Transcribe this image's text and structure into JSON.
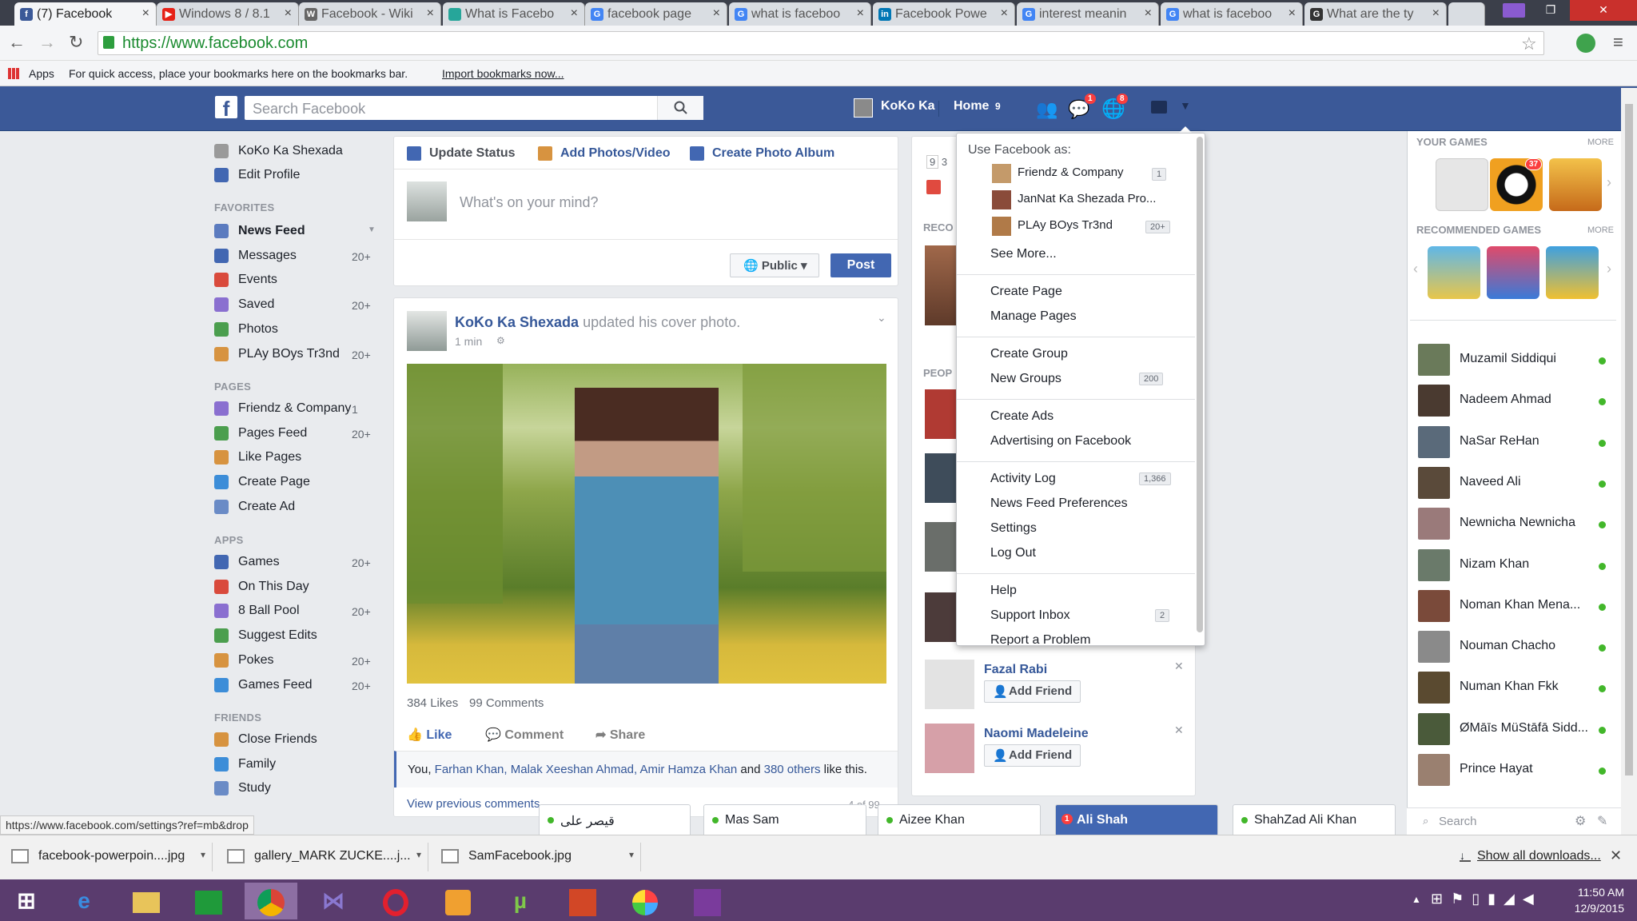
{
  "browser": {
    "tabs": [
      {
        "title": "(7) Facebook",
        "fav": "f",
        "color": "#3b5998",
        "active": true
      },
      {
        "title": "Windows 8 / 8.1",
        "fav": "▶",
        "color": "#e62117"
      },
      {
        "title": "Facebook - Wiki",
        "fav": "W",
        "color": "#666"
      },
      {
        "title": "What is Facebo",
        "fav": "",
        "color": "#26a69a"
      },
      {
        "title": "facebook page",
        "fav": "G",
        "color": "#4285f4"
      },
      {
        "title": "what is faceboo",
        "fav": "G",
        "color": "#4285f4"
      },
      {
        "title": "Facebook Powe",
        "fav": "in",
        "color": "#0077b5"
      },
      {
        "title": "interest meanin",
        "fav": "G",
        "color": "#4285f4"
      },
      {
        "title": "what is faceboo",
        "fav": "G",
        "color": "#4285f4"
      },
      {
        "title": "What are the ty",
        "fav": "G",
        "color": "#333"
      }
    ],
    "url": "https://www.facebook.com",
    "bookmarks_apps": "Apps",
    "bookmarks_hint": "For quick access, place your bookmarks here on the bookmarks bar.",
    "bookmarks_import": "Import bookmarks now...",
    "status_url": "https://www.facebook.com/settings?ref=mb&drop"
  },
  "header": {
    "search_placeholder": "Search Facebook",
    "user_name": "KoKo Ka",
    "home_label": "Home",
    "home_count": "9",
    "msg_badge": "1",
    "notif_badge": "8"
  },
  "left_nav": {
    "profile_name": "KoKo Ka Shexada",
    "edit_profile": "Edit Profile",
    "favorites_heading": "FAVORITES",
    "favorites": [
      {
        "label": "News Feed",
        "count": ""
      },
      {
        "label": "Messages",
        "count": "20+"
      },
      {
        "label": "Events",
        "count": ""
      },
      {
        "label": "Saved",
        "count": "20+"
      },
      {
        "label": "Photos",
        "count": ""
      },
      {
        "label": "PLAy BOys Tr3nd",
        "count": "20+"
      }
    ],
    "pages_heading": "PAGES",
    "pages": [
      {
        "label": "Friendz & Company",
        "count": "1"
      },
      {
        "label": "Pages Feed",
        "count": "20+"
      },
      {
        "label": "Like Pages",
        "count": ""
      },
      {
        "label": "Create Page",
        "count": ""
      },
      {
        "label": "Create Ad",
        "count": ""
      }
    ],
    "apps_heading": "APPS",
    "apps": [
      {
        "label": "Games",
        "count": "20+"
      },
      {
        "label": "On This Day",
        "count": ""
      },
      {
        "label": "8 Ball Pool",
        "count": "20+"
      },
      {
        "label": "Suggest Edits",
        "count": ""
      },
      {
        "label": "Pokes",
        "count": "20+"
      },
      {
        "label": "Games Feed",
        "count": "20+"
      }
    ],
    "friends_heading": "FRIENDS",
    "friends": [
      {
        "label": "Close Friends"
      },
      {
        "label": "Family"
      },
      {
        "label": "Study"
      }
    ]
  },
  "composer": {
    "update_status": "Update Status",
    "add_photos": "Add Photos/Video",
    "create_album": "Create Photo Album",
    "placeholder": "What's on your mind?",
    "privacy": "Public",
    "post": "Post"
  },
  "post": {
    "author": "KoKo Ka Shexada",
    "action": "updated his cover photo.",
    "time": "1 min",
    "likes": "384 Likes",
    "comments": "99 Comments",
    "like": "Like",
    "comment": "Comment",
    "share": "Share",
    "likers_prefix": "You,",
    "liker1": "Farhan Khan,",
    "liker2": "Malak Xeeshan Ahmad,",
    "liker3": "Amir Hamza Khan",
    "and": "and",
    "others": "380 others",
    "like_this": "like this.",
    "view_prev": "View previous comments",
    "comment_pager": "4 of 99"
  },
  "menu": {
    "use_as": "Use Facebook as:",
    "accounts": [
      {
        "label": "Friendz & Company",
        "count": "1"
      },
      {
        "label": "JanNat Ka Shezada Pro...",
        "count": ""
      },
      {
        "label": "PLAy BOys Tr3nd",
        "count": "20+"
      }
    ],
    "see_more": "See More...",
    "create_page": "Create Page",
    "manage_pages": "Manage Pages",
    "create_group": "Create Group",
    "new_groups": "New Groups",
    "new_groups_count": "200",
    "create_ads": "Create Ads",
    "advertising": "Advertising on Facebook",
    "activity_log": "Activity Log",
    "activity_count": "1,366",
    "news_feed_prefs": "News Feed Preferences",
    "settings": "Settings",
    "log_out": "Log Out",
    "help": "Help",
    "support_inbox": "Support Inbox",
    "support_count": "2",
    "report": "Report a Problem"
  },
  "middle": {
    "rec_heading": "RECO",
    "people_heading": "PEOP",
    "count3": "3",
    "suggestions": [
      {
        "name": "Fazal Rabi",
        "button": "Add Friend"
      },
      {
        "name": "Naomi Madeleine",
        "button": "Add Friend"
      }
    ]
  },
  "right": {
    "your_games": "YOUR GAMES",
    "more": "MORE",
    "rec_games": "RECOMMENDED GAMES",
    "game_badge": "37",
    "contacts": [
      {
        "name": "Muzamil Siddiqui"
      },
      {
        "name": "Nadeem Ahmad"
      },
      {
        "name": "NaSar ReHan"
      },
      {
        "name": "Naveed Ali"
      },
      {
        "name": "Newnicha Newnicha"
      },
      {
        "name": "Nizam Khan"
      },
      {
        "name": "Noman Khan Mena..."
      },
      {
        "name": "Nouman Chacho"
      },
      {
        "name": "Numan Khan Fkk"
      },
      {
        "name": "ØMāīs MüStāfā Sidd..."
      },
      {
        "name": "Prince Hayat"
      }
    ],
    "search": "Search"
  },
  "chat_tabs": [
    {
      "name": "قیصر علی"
    },
    {
      "name": "Mas Sam"
    },
    {
      "name": "Aizee Khan"
    },
    {
      "name": "Ali Shah",
      "badge": "1"
    },
    {
      "name": "ShahZad Ali Khan"
    }
  ],
  "downloads": {
    "items": [
      "facebook-powerpoin....jpg",
      "gallery_MARK ZUCKE....j...",
      "SamFacebook.jpg"
    ],
    "show_all": "Show all downloads..."
  },
  "taskbar": {
    "time": "11:50 AM",
    "date": "12/9/2015"
  }
}
